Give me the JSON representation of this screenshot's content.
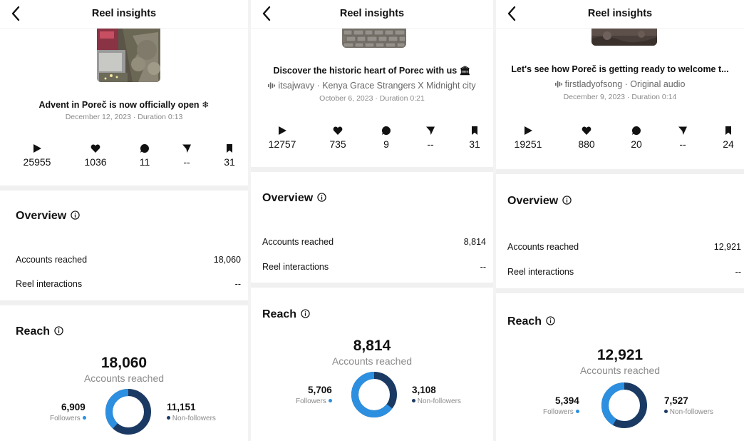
{
  "header_title": "Reel insights",
  "colors": {
    "followers": "#2c8fe0",
    "non_followers": "#1b3a63",
    "band": "#f0f0f0"
  },
  "icons": {
    "back": "chevron-left-icon",
    "plays": "play-icon",
    "likes": "heart-icon",
    "comments": "comment-icon",
    "shares": "send-icon",
    "saves": "bookmark-icon",
    "audio": "audio-wave-icon",
    "info": "info-circle-icon"
  },
  "labels": {
    "overview": "Overview",
    "reach": "Reach",
    "accounts_reached": "Accounts reached",
    "reel_interactions": "Reel interactions",
    "accounts_reached_sub": "Accounts reached",
    "followers": "Followers",
    "non_followers": "Non-followers"
  },
  "screens": [
    {
      "title": "Advent in Poreč is now officially open ❄",
      "audio": "",
      "meta": "December 12, 2023 · Duration 0:13",
      "stats": {
        "plays": "25955",
        "likes": "1036",
        "comments": "11",
        "shares": "--",
        "saves": "31"
      },
      "accounts_reached": "18,060",
      "reel_interactions": "--",
      "reach_total": "18,060",
      "followers": "6,909",
      "non_followers": "11,151",
      "followers_share": 0.3826
    },
    {
      "title": "Discover the historic heart of Porec with us 🏛",
      "audio": "itsajwavy · Kenya Grace Strangers X Midnight city",
      "meta": "October 6, 2023 · Duration 0:21",
      "stats": {
        "plays": "12757",
        "likes": "735",
        "comments": "9",
        "shares": "--",
        "saves": "31"
      },
      "accounts_reached": "8,814",
      "reel_interactions": "--",
      "reach_total": "8,814",
      "followers": "5,706",
      "non_followers": "3,108",
      "followers_share": 0.6474
    },
    {
      "title": "Let's see how Poreč is getting ready to welcome t...",
      "audio": "firstladyofsong · Original audio",
      "meta": "December 9, 2023 · Duration 0:14",
      "stats": {
        "plays": "19251",
        "likes": "880",
        "comments": "20",
        "shares": "--",
        "saves": "24"
      },
      "accounts_reached": "12,921",
      "reel_interactions": "--",
      "reach_total": "12,921",
      "followers": "5,394",
      "non_followers": "7,527",
      "followers_share": 0.4175
    }
  ]
}
